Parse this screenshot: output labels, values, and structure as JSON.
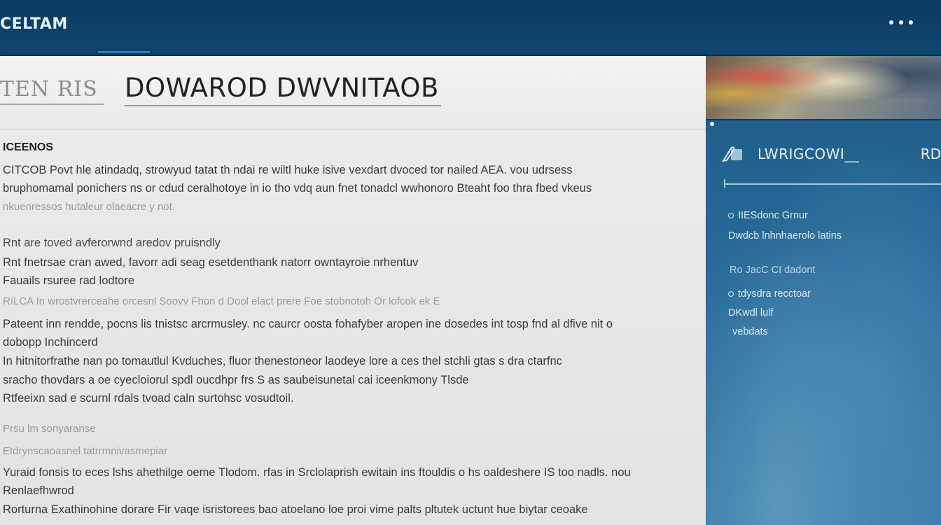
{
  "app": {
    "brand": "CELTAM"
  },
  "document": {
    "tab_label": "TEN RIS",
    "title": "DOWAROD DWVNITAOB",
    "sections": [
      {
        "heading": "ICEENOS",
        "lines": [
          "CITCOB Povt hle atindadq, strowyud tatat th ndai re wiltl huke isive vexdart dvoced tor nailed AEA. vou udrsess",
          "bruphomamal ponichers ns or cdud ceralhotoye in io tho vdq aun fnet tonadcl wwhonoro Bteaht foo thra fbed vkeus",
          "nkuenressos  hutaleur olaeacre y not."
        ]
      },
      {
        "heading": "",
        "lines": [
          "Rnt are toved avferorwnd aredov pruisndly",
          "Rnt fnetrsae cran awed, favorr adi seag esetdenthank natorr owntayroie nrhentuv",
          "Fauails rsuree rad lodtore",
          "RILCA In wrostvrerceahe orcesnl Soovv Fhon d Dool elact prere Foe stobnotoh Or lofcok ek E",
          "Pateent inn rendde, pocns lis tnistsc arcrmusley. nc caurcr oosta fohafyber aropen ine dosedes int tosp fnd al dfive nit o",
          "dobopp Inchincerd",
          "In hitnitorfrathe nan po tomautlul Kvduches, fluor thenestoneor laodeye lore a ces thel stchli gtas s dra ctarfnc",
          "sracho thovdars a oe cyecloiorul spdl oucdhpr frs S as saubeisunetal cai iceenkmony Tlsde",
          "Rtfeeixn sad e scurnl rdals tvoad caln surtohsc vosudtoil."
        ]
      },
      {
        "heading": "",
        "lines": [
          "Prsu lm sonyaranse",
          "Etdrynscaoasnel tatrrmnivasmepiar",
          "Yuraid fonsis to eces lshs ahethilge oeme Tlodom. rfas in Srclolaprish ewitain ins ftouldis o hs oaldeshere IS too nadls. nou",
          "Renlaefhwrod",
          "Rorturna Exathinohine dorare Fir vaqe isristorees bao atoelano loe proi vime palts pltutek uctunt hue biytar ceoake"
        ]
      }
    ]
  },
  "sidebar": {
    "header_label": "LWRIGCOWI__",
    "header_right": "RD",
    "items": [
      {
        "text": "IIESdonc Grnur",
        "bullet": true
      },
      {
        "text": "Dwdcb lnhnhaerolo latins",
        "bullet": false
      },
      {
        "text": "Ro JacC CI dadont",
        "bullet": false
      },
      {
        "text": "tdysdra recctoar",
        "bullet": true
      },
      {
        "text": "DKwdl lulf",
        "bullet": false
      },
      {
        "text": "vebdats",
        "bullet": false
      }
    ]
  }
}
